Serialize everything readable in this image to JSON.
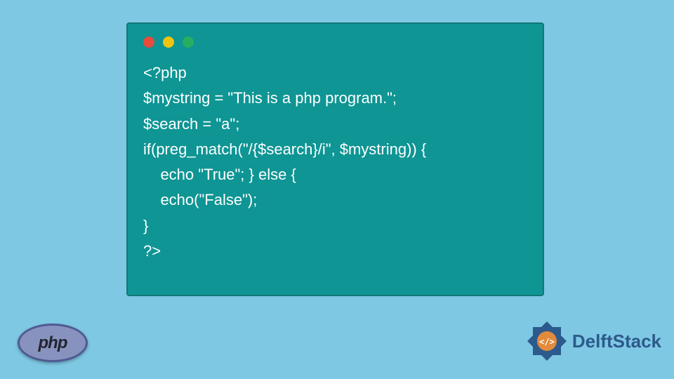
{
  "code": {
    "line1": "<?php",
    "line2": "$mystring = \"This is a php program.\";",
    "line3": "$search = \"a\";",
    "line4": "if(preg_match(\"/{$search}/i\", $mystring)) {",
    "line5": "    echo \"True\"; } else {",
    "line6": "    echo(\"False\");",
    "line7": "}",
    "line8": "?>"
  },
  "phpLogo": {
    "text": "php"
  },
  "brand": {
    "name": "DelftStack"
  },
  "colors": {
    "background": "#7EC8E3",
    "windowBg": "#0E9594",
    "phpLogoBg": "#8892BF",
    "brandText": "#2C5A8C"
  }
}
